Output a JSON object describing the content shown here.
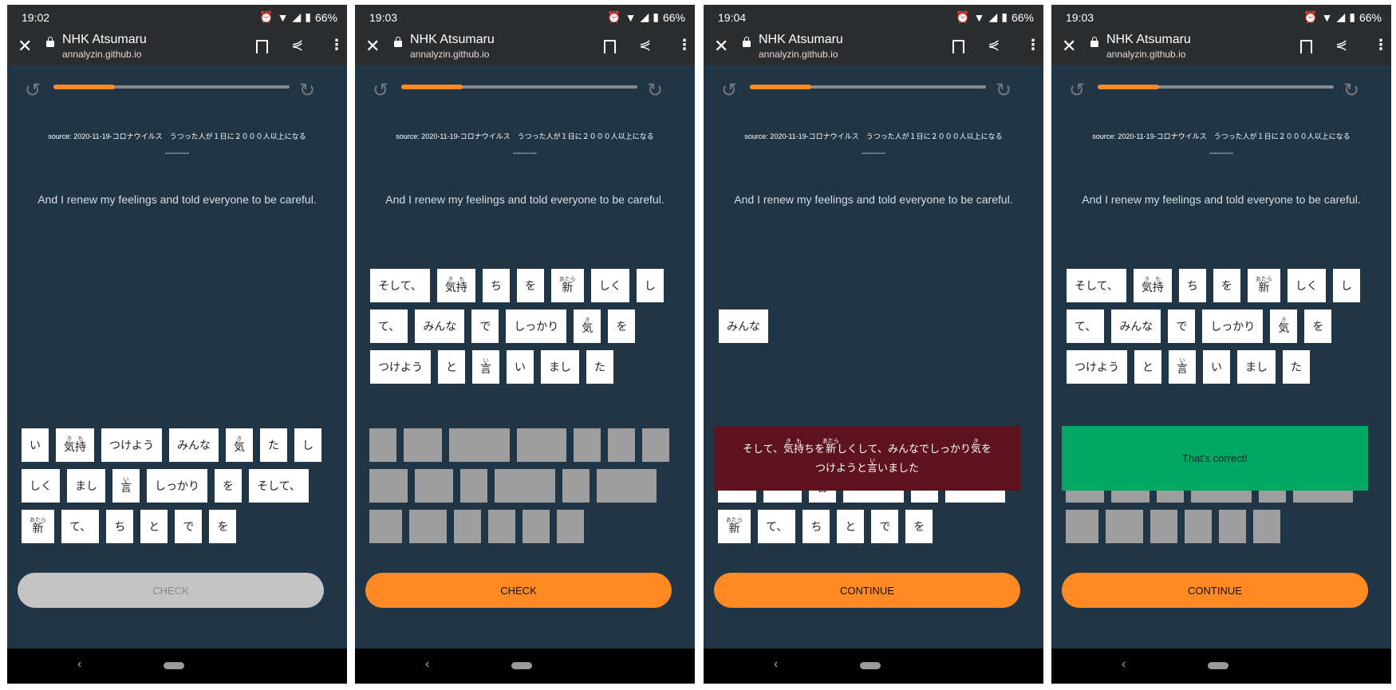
{
  "browser": {
    "title": "NHK Atsumaru",
    "url": "annalyzin.github.io",
    "battery": "66%"
  },
  "lesson": {
    "source": "source: 2020-11-19-コロナウイルス　うつった人が１日に２０００人以上になる",
    "dashes": "---------",
    "english": "And I renew my feelings and told everyone to be careful.",
    "progress_percent": 26
  },
  "colors": {
    "background": "#203647",
    "accent": "#ff8a24",
    "wrong": "#5e121f",
    "correct": "#00a862"
  },
  "icons": {
    "undo": "undo-icon",
    "redo": "redo-icon",
    "close": "close-icon",
    "lock": "lock-icon",
    "bookmark": "bookmark-icon",
    "share": "share-icon",
    "more": "more-vert-icon"
  },
  "bank": [
    {
      "text": "い"
    },
    {
      "text": "気持",
      "ruby": "きも"
    },
    {
      "text": "つけよう"
    },
    {
      "text": "みんな"
    },
    {
      "text": "気",
      "ruby": "き"
    },
    {
      "text": "た"
    },
    {
      "text": "し"
    },
    {
      "text": "しく"
    },
    {
      "text": "まし"
    },
    {
      "text": "言",
      "ruby": "い"
    },
    {
      "text": "しっかり"
    },
    {
      "text": "を"
    },
    {
      "text": "そして、"
    },
    {
      "text": "新",
      "ruby": "あたら"
    },
    {
      "text": "て、"
    },
    {
      "text": "ち"
    },
    {
      "text": "と"
    },
    {
      "text": "で"
    },
    {
      "text": "を"
    }
  ],
  "screens": [
    {
      "time": "19:02",
      "answer": [],
      "used": [],
      "button": "CHECK",
      "button_enabled": false,
      "feedback": null
    },
    {
      "time": "19:03",
      "answer": [
        12,
        1,
        15,
        11,
        13,
        7,
        6,
        14,
        3,
        17,
        10,
        4,
        18,
        2,
        16,
        9,
        0,
        8,
        5
      ],
      "used": [
        0,
        1,
        2,
        3,
        4,
        5,
        6,
        7,
        8,
        9,
        10,
        11,
        12,
        13,
        14,
        15,
        16,
        17,
        18
      ],
      "button": "CHECK",
      "button_enabled": true,
      "feedback": null
    },
    {
      "time": "19:04",
      "answer": [
        3
      ],
      "used": [
        3
      ],
      "button": "CONTINUE",
      "button_enabled": true,
      "feedback": {
        "type": "wrong",
        "segments": [
          {
            "text": "そして、"
          },
          {
            "text": "気持",
            "ruby": "きも"
          },
          {
            "text": "ちを"
          },
          {
            "text": "新",
            "ruby": "あたら"
          },
          {
            "text": "しくして、みんなでしっかり"
          },
          {
            "text": "気",
            "ruby": "き"
          },
          {
            "text": "を"
          },
          {
            "br": true
          },
          {
            "text": "つけようと"
          },
          {
            "text": "言",
            "ruby": "い"
          },
          {
            "text": "いました"
          }
        ]
      }
    },
    {
      "time": "19:03",
      "answer": [
        12,
        1,
        15,
        11,
        13,
        7,
        6,
        14,
        3,
        17,
        10,
        4,
        18,
        2,
        16,
        9,
        0,
        8,
        5
      ],
      "used": [
        0,
        1,
        2,
        3,
        4,
        5,
        6,
        7,
        8,
        9,
        10,
        11,
        12,
        13,
        14,
        15,
        16,
        17,
        18
      ],
      "button": "CONTINUE",
      "button_enabled": true,
      "feedback": {
        "type": "correct",
        "segments": [
          {
            "text": "That's correct!"
          }
        ]
      }
    }
  ]
}
